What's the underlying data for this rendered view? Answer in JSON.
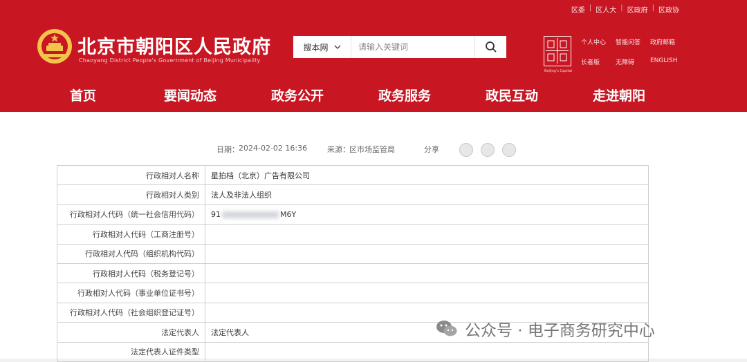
{
  "top_links": [
    "区委",
    "区人大",
    "区政府",
    "区政协"
  ],
  "site": {
    "title": "北京市朝阳区人民政府",
    "subtitle": "Chaoyang District People's Government of Beijing Municipality"
  },
  "search": {
    "scope": "搜本网",
    "placeholder": "请输入关键词"
  },
  "logo_caption": "Beijing's Capital",
  "quick_links": [
    "个人中心",
    "智能问答",
    "政府邮箱",
    "长者版",
    "无障碍",
    "ENGLISH"
  ],
  "nav": [
    "首页",
    "要闻动态",
    "政务公开",
    "政务服务",
    "政民互动",
    "走进朝阳"
  ],
  "meta": {
    "date_label": "日期：",
    "date": "2024-02-02 16:36",
    "source_label": "来源：",
    "source": "区市场监管局",
    "share_label": "分享"
  },
  "table": {
    "rows": [
      {
        "label": "行政相对人名称",
        "value": "星拍档（北京）广告有限公司"
      },
      {
        "label": "行政相对人类别",
        "value": "法人及非法人组织"
      },
      {
        "label": "行政相对人代码（统一社会信用代码）",
        "value_prefix": "91",
        "value_suffix": "M6Y"
      },
      {
        "label": "行政相对人代码（工商注册号）",
        "value": ""
      },
      {
        "label": "行政相对人代码（组织机构代码）",
        "value": ""
      },
      {
        "label": "行政相对人代码（税务登记号）",
        "value": ""
      },
      {
        "label": "行政相对人代码（事业单位证书号）",
        "value": ""
      },
      {
        "label": "行政相对人代码（社会组织登记证号）",
        "value": ""
      },
      {
        "label": "法定代表人",
        "value": "法定代表人"
      },
      {
        "label": "法定代表人证件类型",
        "value": ""
      }
    ]
  },
  "watermark": "公众号 · 电子商务研究中心",
  "colors": {
    "brand_red": "#c81623",
    "emblem_gold": "#f3c44b"
  }
}
